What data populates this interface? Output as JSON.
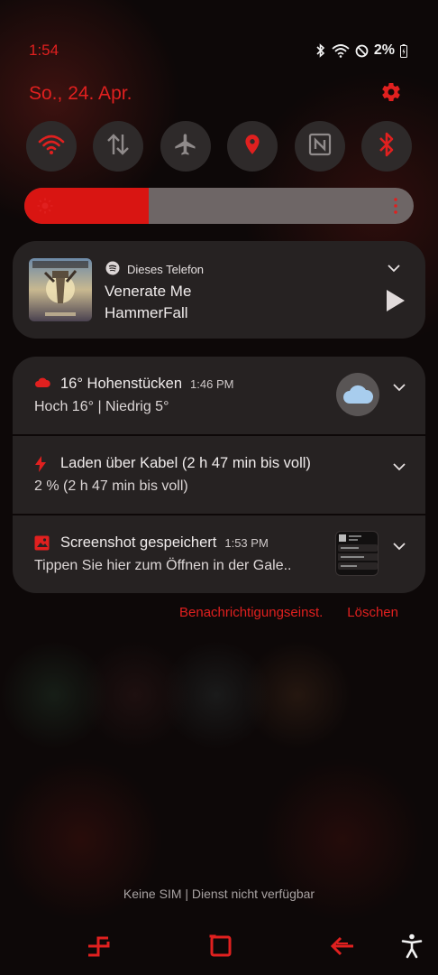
{
  "status": {
    "time": "1:54",
    "battery": "2%"
  },
  "header": {
    "date": "So., 24. Apr."
  },
  "quick_tiles": [
    {
      "name": "wifi",
      "active": true
    },
    {
      "name": "mobile-data",
      "active": false
    },
    {
      "name": "airplane-mode",
      "active": false
    },
    {
      "name": "location",
      "active": true
    },
    {
      "name": "nfc",
      "active": false
    },
    {
      "name": "bluetooth",
      "active": true
    }
  ],
  "brightness": {
    "level": 0.32
  },
  "media": {
    "source": "Dieses Telefon",
    "title": "Venerate Me",
    "artist": "HammerFall"
  },
  "notifications": [
    {
      "title": "16° Hohenstücken",
      "time": "1:46 PM",
      "body": "Hoch 16° | Niedrig 5°"
    },
    {
      "title": "Laden über Kabel (2 h 47 min bis voll)",
      "time": "",
      "body": "2 % (2 h 47 min bis voll)"
    },
    {
      "title": "Screenshot gespeichert",
      "time": "1:53 PM",
      "body": "Tippen Sie hier zum Öffnen in der Gale.."
    }
  ],
  "actions": {
    "settings_label": "Benachrichtigungseinst.",
    "clear_label": "Löschen"
  },
  "footer": {
    "sim_status": "Keine SIM | Dienst nicht verfügbar"
  },
  "colors": {
    "accent": "#e0201f",
    "tile_bg": "#2e2a2a",
    "card_bg": "#262222"
  }
}
